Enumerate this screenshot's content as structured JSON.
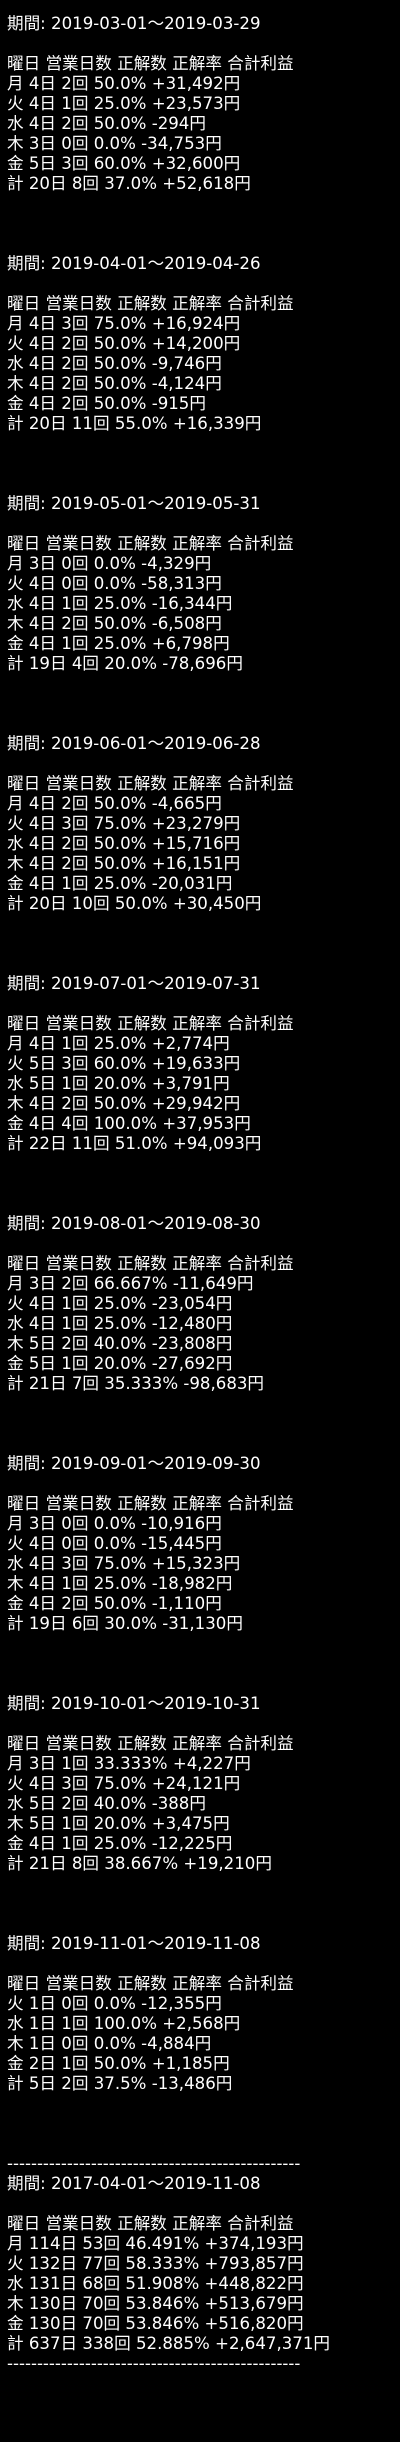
{
  "periods": [
    {
      "period": "期間: 2019-03-01～2019-03-29",
      "header": "曜日 営業日数 正解数 正解率 合計利益",
      "rows": [
        "月 4日 2回 50.0% +31,492円",
        "火 4日 1回 25.0% +23,573円",
        "水 4日 2回 50.0% -294円",
        "木 3日 0回 0.0% -34,753円",
        "金 5日 3回 60.0% +32,600円"
      ],
      "total": "計 20日 8回 37.0% +52,618円"
    },
    {
      "period": "期間: 2019-04-01～2019-04-26",
      "header": "曜日 営業日数 正解数 正解率 合計利益",
      "rows": [
        "月 4日 3回 75.0% +16,924円",
        "火 4日 2回 50.0% +14,200円",
        "水 4日 2回 50.0% -9,746円",
        "木 4日 2回 50.0% -4,124円",
        "金 4日 2回 50.0% -915円"
      ],
      "total": "計 20日 11回 55.0% +16,339円"
    },
    {
      "period": "期間: 2019-05-01～2019-05-31",
      "header": "曜日 営業日数 正解数 正解率 合計利益",
      "rows": [
        "月 3日 0回 0.0% -4,329円",
        "火 4日 0回 0.0% -58,313円",
        "水 4日 1回 25.0% -16,344円",
        "木 4日 2回 50.0% -6,508円",
        "金 4日 1回 25.0% +6,798円"
      ],
      "total": "計 19日 4回 20.0% -78,696円"
    },
    {
      "period": "期間: 2019-06-01～2019-06-28",
      "header": "曜日 営業日数 正解数 正解率 合計利益",
      "rows": [
        "月 4日 2回 50.0% -4,665円",
        "火 4日 3回 75.0% +23,279円",
        "水 4日 2回 50.0% +15,716円",
        "木 4日 2回 50.0% +16,151円",
        "金 4日 1回 25.0% -20,031円"
      ],
      "total": "計 20日 10回 50.0% +30,450円"
    },
    {
      "period": "期間: 2019-07-01～2019-07-31",
      "header": "曜日 営業日数 正解数 正解率 合計利益",
      "rows": [
        "月 4日 1回 25.0% +2,774円",
        "火 5日 3回 60.0% +19,633円",
        "水 5日 1回 20.0% +3,791円",
        "木 4日 2回 50.0% +29,942円",
        "金 4日 4回 100.0% +37,953円"
      ],
      "total": "計 22日 11回 51.0% +94,093円"
    },
    {
      "period": "期間: 2019-08-01～2019-08-30",
      "header": "曜日 営業日数 正解数 正解率 合計利益",
      "rows": [
        "月 3日 2回 66.667% -11,649円",
        "火 4日 1回 25.0% -23,054円",
        "水 4日 1回 25.0% -12,480円",
        "木 5日 2回 40.0% -23,808円",
        "金 5日 1回 20.0% -27,692円"
      ],
      "total": "計 21日 7回 35.333% -98,683円"
    },
    {
      "period": "期間: 2019-09-01～2019-09-30",
      "header": "曜日 営業日数 正解数 正解率 合計利益",
      "rows": [
        "月 3日 0回 0.0% -10,916円",
        "火 4日 0回 0.0% -15,445円",
        "水 4日 3回 75.0% +15,323円",
        "木 4日 1回 25.0% -18,982円",
        "金 4日 2回 50.0% -1,110円"
      ],
      "total": "計 19日 6回 30.0% -31,130円"
    },
    {
      "period": "期間: 2019-10-01～2019-10-31",
      "header": "曜日 営業日数 正解数 正解率 合計利益",
      "rows": [
        "月 3日 1回 33.333% +4,227円",
        "火 4日 3回 75.0% +24,121円",
        "水 5日 2回 40.0% -388円",
        "木 5日 1回 20.0% +3,475円",
        "金 4日 1回 25.0% -12,225円"
      ],
      "total": "計 21日 8回 38.667% +19,210円"
    },
    {
      "period": "期間: 2019-11-01～2019-11-08",
      "header": "曜日 営業日数 正解数 正解率 合計利益",
      "rows": [
        "火 1日 0回 0.0% -12,355円",
        "水 1日 1回 100.0% +2,568円",
        "木 1日 0回 0.0% -4,884円",
        "金 2日 1回 50.0% +1,185円"
      ],
      "total": "計 5日 2回 37.5% -13,486円"
    }
  ],
  "separator": "-------------------------------------------------",
  "summary": {
    "period": "期間: 2017-04-01～2019-11-08",
    "header": "曜日 営業日数 正解数 正解率 合計利益",
    "rows": [
      "月 114日 53回 46.491% +374,193円",
      "火 132日 77回 58.333% +793,857円",
      "水 131日 68回 51.908% +448,822円",
      "木 130日 70回 53.846% +513,679円",
      "金 130日 70回 53.846% +516,820円"
    ],
    "total": "計 637日 338回 52.885% +2,647,371円"
  }
}
